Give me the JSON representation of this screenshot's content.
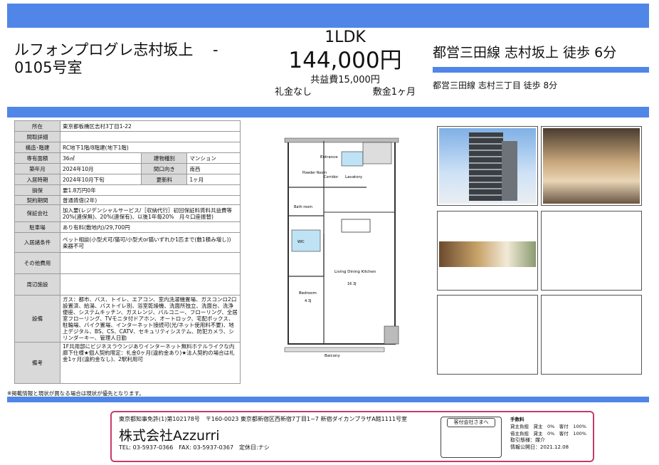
{
  "header": {
    "title": "ルフォンプログレ志村坂上　 - 0105号室",
    "layout": "1LDK",
    "rent": "144,000円",
    "common_fee": "共益費15,000円",
    "key_money": "礼金なし",
    "deposit": "敷金1ヶ月",
    "station_main": "都営三田線 志村坂上 徒歩 6分",
    "station_sub": "都営三田線 志村三丁目 徒歩 8分"
  },
  "spec": {
    "location_label": "所在",
    "location": "東京都板橋区志村3丁目1-22",
    "floor_detail_label": "間取詳細",
    "floor_detail": "",
    "structure_label": "構造･階建",
    "structure": "RC地下1階/8階建(地下1階)",
    "area_label": "専有面積",
    "area": "36㎡",
    "building_type_label": "建物種別",
    "building_type": "マンション",
    "built_label": "築年月",
    "built": "2024年10月",
    "direction_label": "間口向き",
    "direction": "南西",
    "movein_label": "入居時期",
    "movein": "2024年10月下旬",
    "renewal_label": "更新料",
    "renewal": "1ヶ月",
    "amortization_label": "損保",
    "amortization": "要1.8万円0年",
    "contract_label": "契約期間",
    "contract": "普通賃借(2年)",
    "guarantee_label": "保証会社",
    "guarantee": "加入要(レジデンシャルサービス/［収納代行］初回保証料賃料共益費等20%(連保無)、20%(連保有)、以後1年毎20%　月々口座振替)",
    "parking_label": "駐車場",
    "parking": "あり有料(敷地内)/29,700円",
    "conditions_label": "入居諸条件",
    "conditions": "ペット相談(小型犬可/猫可/小型犬or猫いずれか1匹まで(敷1積み増し))　楽器不可",
    "other_costs_label": "その他費用",
    "other_costs": "",
    "surroundings_label": "周辺施設",
    "surroundings": "",
    "equipment_label": "設備",
    "equipment": "ガス：都市、バス、トイレ、エアコン、室内洗濯機置場、ガスコンロ2口設置済、給湯、バストイレ別、浴室乾燥機、洗面所独立、洗面台、洗浄便座、システムキッチン、ガスレンジ、バルコニー、フローリング、全居室フローリング、TVモニタ付ドアホン、オートロック、宅配ボックス、駐輪場、バイク置場、インターネット接続可(光/ネット使用料不要)、地上デジタル、BS、CS、CATV、セキュリティシステム、防犯カメラ、シリンダーキー、管理人日勤",
    "remarks_label": "備考",
    "remarks": "1F共用部にビジネスラウンジありインターネット無料ホテルライクな内廊下仕様★個人契約限定：礼金0ヶ月(違約金あり)★法人契約の場合は礼金1ヶ月(違約金なし)、2駅利用可"
  },
  "plan": {
    "entrance": "Entrance",
    "powder": "Powder Room",
    "corridor": "Corridor",
    "lavatory": "Lavatory",
    "bath": "Bath room",
    "wic": "WIC",
    "ldk": "Living Dining Kitchen",
    "ldk_size": "16.3J",
    "bedroom": "Bedroom",
    "bed_size": "4.3J",
    "balcony": "Balcony"
  },
  "note": "※掲載情報と現状が異なる場合は現状が優先となります。",
  "footer": {
    "license_address": "東京都知事免許(1)第102178号　〒160-0023 東京都新宿区西新宿7丁目1−7 新宿ダイカンプラザA館1111号室",
    "company": "株式会社Azzurri",
    "contact": "TEL: 03-5937-0366　FAX: 03-5937-0367　定休日:ナシ",
    "stamp_label": "客付会社さまへ",
    "fee_title": "手数料",
    "fee_row1": "貸主負担　貸主　0%　客付　100%",
    "fee_row2": "借主負担　貸主　0%　客付　100%",
    "transaction": "取引態様：媒介",
    "info_date": "情報公開日：2021.12.08"
  }
}
